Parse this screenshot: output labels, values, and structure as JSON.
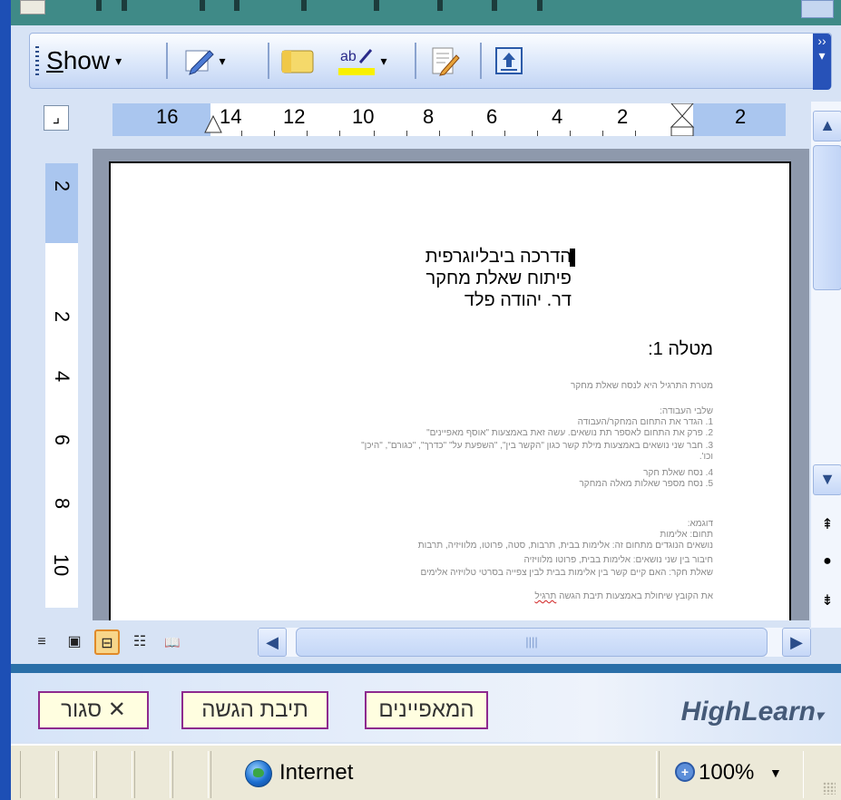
{
  "toolbar": {
    "show_label": "Show",
    "show_underlined_letter": "S",
    "show_rest": "how",
    "caret": "▾"
  },
  "ruler": {
    "corner": "⌟",
    "horizontal_labels": [
      "16",
      "14",
      "12",
      "10",
      "8",
      "6",
      "4",
      "2",
      "2"
    ],
    "vertical_labels": [
      "2",
      "2",
      "4",
      "6",
      "8",
      "10"
    ]
  },
  "document": {
    "heading_lines": [
      "הדרכה ביבליוגרפית",
      "פיתוח שאלת מחקר",
      "דר. יהודה פלד"
    ],
    "task_title": "מטלה 1:",
    "small_intro": "מטרת התרגיל היא לנסח שאלת מחקר",
    "small_steps_title": "שלבי העבודה:",
    "small_steps": [
      "1.   הגדר את התחום המחקר/העבודה",
      "2.   פרק את התחום לאספר תת נושאים. עשה זאת באמצעות \"אוסף מאפיינים\"",
      "3.   חבר שני נושאים באמצעות מילת קשר כגון \"הקשר בין\", \"השפעת על\" \"כדרך\", \"כגורם\", \"היכן\"",
      "        וכו'.",
      "4.   נסח שאלת חקר",
      "5.   נסח מספר שאלות מאלה המחקר"
    ],
    "small_example_title": "דוגמא:",
    "small_example_lines": [
      "תחום: אלימות",
      "נושאים הנוגדים מתחום זה: אלימות בבית, תרבות, סטה, פרוטו, מלוויזיה, תרבות",
      "חיבור בין שני נושאים: אלימות בבית, פרוטו מלוויזיה",
      "שאלת חקר: האם קיים קשר בין אלימות בבית לבין צפייה בסרטי טלויזיה אלימים"
    ],
    "small_last_line": "את הקובץ שיחולת באמצעות תיבת הגשה",
    "small_last_squiggle": "תרגיל"
  },
  "scroll": {
    "up": "▲",
    "down": "▼",
    "left": "◀",
    "right": "▶",
    "prev_page": "⇞",
    "browse": "●",
    "next_page": "⇟",
    "grip": "||||"
  },
  "views": [
    "≡",
    "▣",
    "⊟",
    "☷",
    "📖"
  ],
  "footer": {
    "close_button": "סגור ✕",
    "submit_button": "תיבת הגשה",
    "properties_button": "המאפיינים",
    "brand": "HighLearn"
  },
  "status": {
    "zone": "Internet",
    "zoom": "100%",
    "zoom_caret": "▼"
  }
}
